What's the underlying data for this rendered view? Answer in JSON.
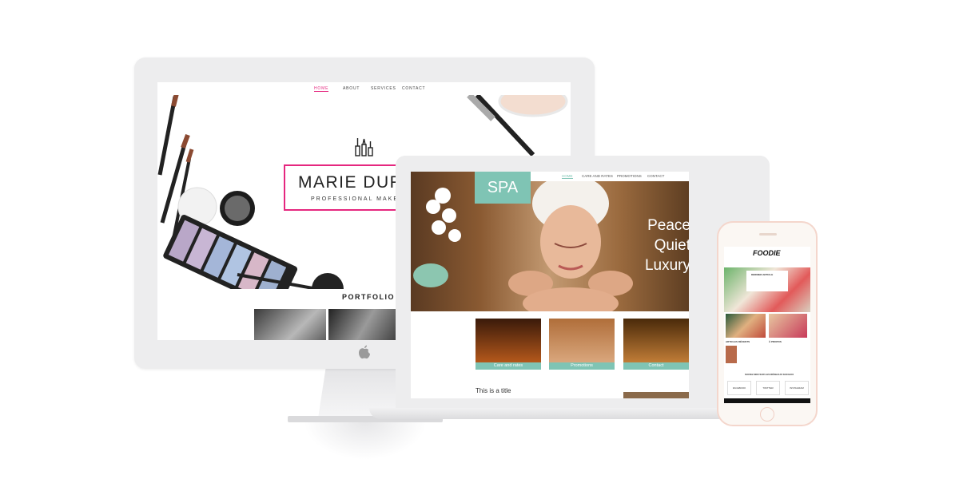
{
  "desktop_site": {
    "nav": [
      "HOME",
      "ABOUT",
      "SERVICES",
      "CONTACT"
    ],
    "title": "MARIE DURA",
    "subtitle": "PROFESSIONAL MAKEUP",
    "section_heading": "PORTFOLIO"
  },
  "spa_site": {
    "logo": "SPA",
    "nav": [
      "HOME",
      "CARE AND RATES",
      "PROMOTIONS",
      "CONTACT"
    ],
    "hero_lines": [
      "Peace",
      "Quiet",
      "Luxury"
    ],
    "tiles": [
      "Care and rates",
      "Promotions",
      "Contact"
    ],
    "content_title": "This is a title"
  },
  "phone_site": {
    "logo": "FOODIE",
    "heading": "DERNIER ARTICLE",
    "recent": "ARTICLES RÉCENTS",
    "about": "À PROPOS",
    "social": "SUIVEZ-MOI SUR LES RÉSEAUX SOCIAUX",
    "social_buttons": [
      "FACEBOOK",
      "TWITTER",
      "INSTAGRAM"
    ]
  },
  "colors": {
    "pink_accent": "#e5277f",
    "spa_teal": "#7fc4b4",
    "device_gray": "#ededee",
    "phone_rose": "#f4d6cc"
  }
}
